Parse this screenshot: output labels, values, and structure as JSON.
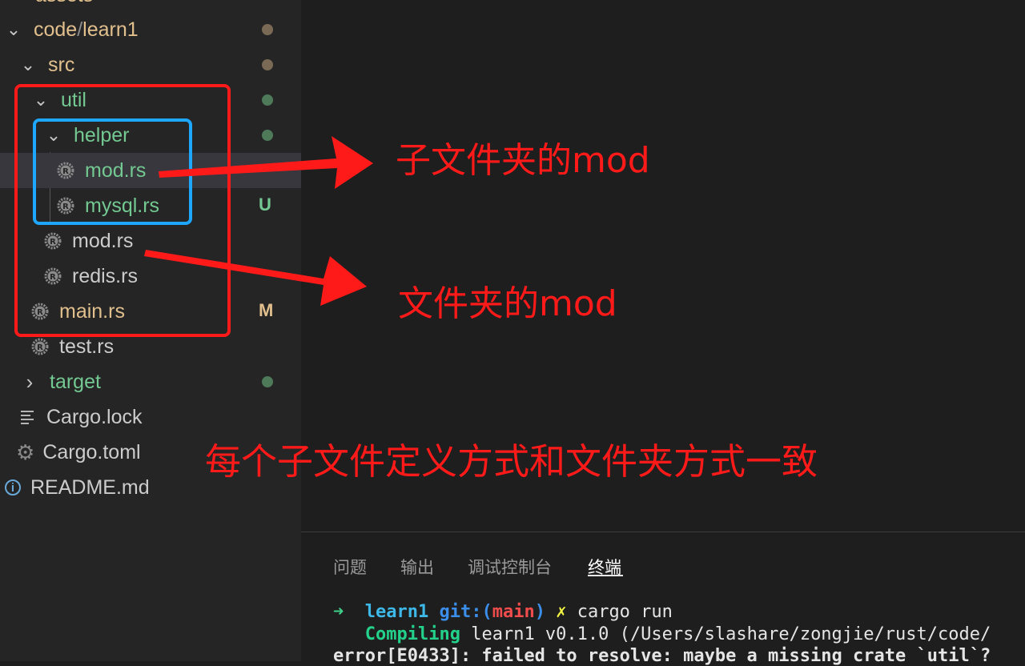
{
  "explorer": {
    "items": [
      {
        "label": "assets",
        "partial": true
      },
      {
        "label": "code",
        "sep": " / ",
        "label2": "learn1"
      },
      {
        "label": "src"
      },
      {
        "label": "util"
      },
      {
        "label": "helper"
      },
      {
        "label": "mod.rs"
      },
      {
        "label": "mysql.rs",
        "badge": "U"
      },
      {
        "label": "mod.rs"
      },
      {
        "label": "redis.rs"
      },
      {
        "label": "main.rs",
        "badge": "M"
      },
      {
        "label": "test.rs"
      },
      {
        "label": "target"
      },
      {
        "label": "Cargo.lock"
      },
      {
        "label": "Cargo.toml"
      },
      {
        "label": "README.md"
      }
    ]
  },
  "panel": {
    "tabs": [
      "问题",
      "输出",
      "调试控制台",
      "终端"
    ],
    "active_tab": "终端"
  },
  "terminal": {
    "prompt_arrow": "➜",
    "dir": "learn1",
    "git_label": "git:(",
    "branch": "main",
    "git_close": ")",
    "dirty": "✗",
    "command": "cargo run",
    "compiling_label": "Compiling",
    "compiling_text": "learn1 v0.1.0 (/Users/slashare/zongjie/rust/code/",
    "error_text": "error[E0433]: failed to resolve: maybe a missing crate `util`?"
  },
  "annotations": {
    "sub_folder_mod": "子文件夹的mod",
    "folder_mod": "文件夹的mod",
    "consistent": "每个子文件定义方式和文件夹方式一致"
  },
  "colors": {
    "green": "#73c991",
    "yellow": "#e2c08d",
    "annotation_red": "#ff1a1a",
    "box_red": "#ff1a1a",
    "box_blue": "#1ea7ff"
  }
}
